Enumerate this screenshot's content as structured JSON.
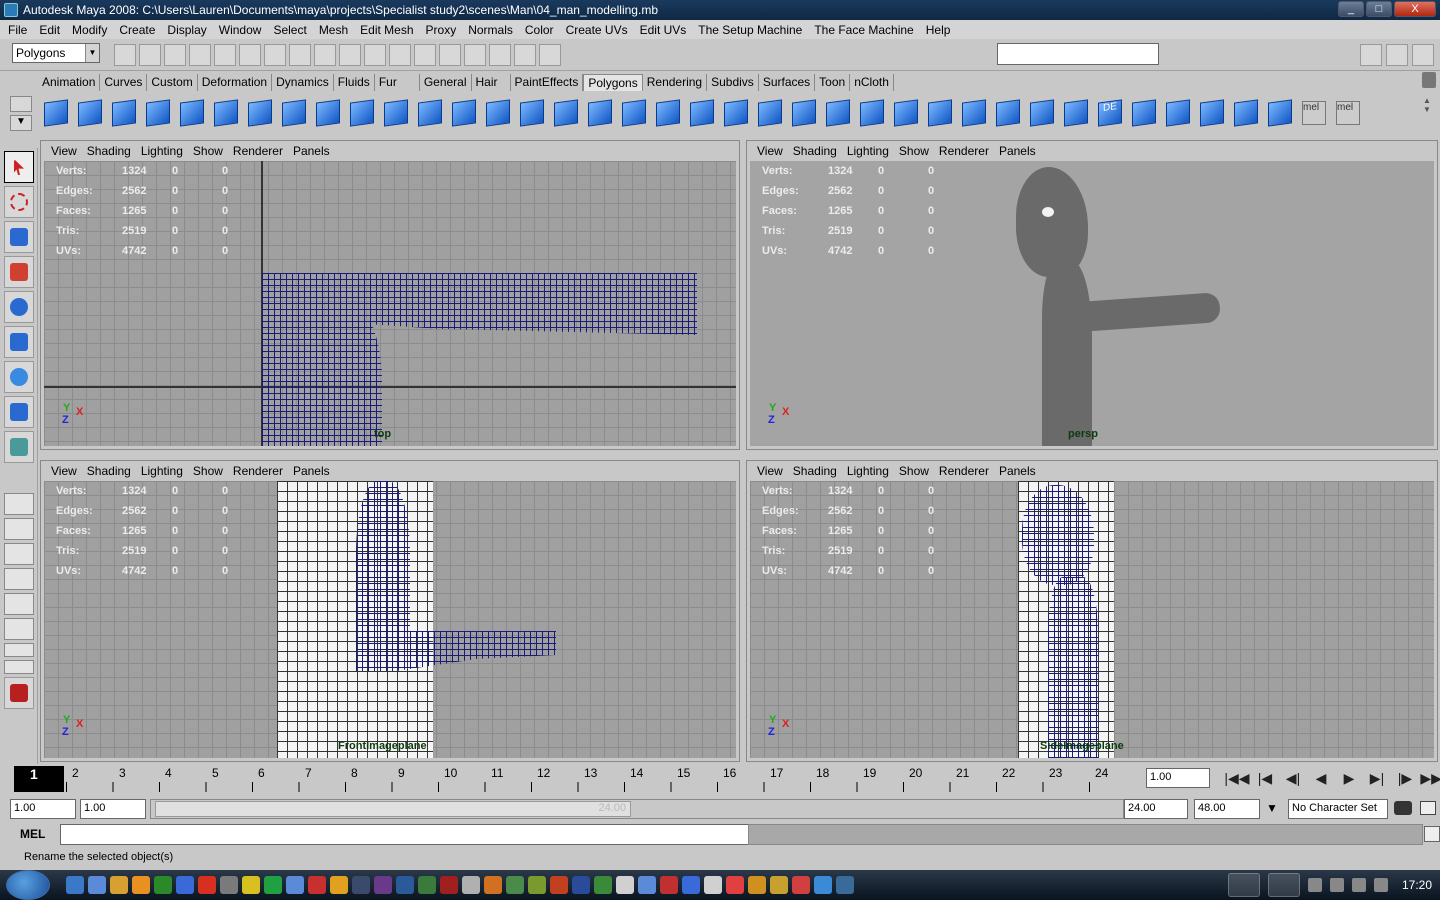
{
  "window": {
    "title": "Autodesk Maya 2008: C:\\Users\\Lauren\\Documents\\maya\\projects\\Specialist study2\\scenes\\Man\\04_man_modelling.mb",
    "min": "_",
    "max": "□",
    "close": "X"
  },
  "menu": [
    "File",
    "Edit",
    "Modify",
    "Create",
    "Display",
    "Window",
    "Select",
    "Mesh",
    "Edit Mesh",
    "Proxy",
    "Normals",
    "Color",
    "Create UVs",
    "Edit UVs",
    "The Setup Machine",
    "The Face Machine",
    "Help"
  ],
  "status_line": {
    "mode": "Polygons",
    "quick_field": ""
  },
  "shelf_tabs": [
    "Animation",
    "Curves",
    "Custom",
    "Deformation",
    "Dynamics",
    "Fluids",
    "Fur",
    "General",
    "Hair",
    "PaintEffects",
    "Polygons",
    "Rendering",
    "Subdivs",
    "Surfaces",
    "Toon",
    "nCloth"
  ],
  "active_shelf_tab": "Polygons",
  "shelf_icons": [
    "poly-sphere",
    "poly-cube",
    "poly-cylinder",
    "poly-cone",
    "poly-plane",
    "poly-torus",
    "poly-prism",
    "poly-pipe",
    "poly-helix",
    "combine",
    "separate",
    "extract",
    "smooth",
    "boolean",
    "average-vertices",
    "extrude-face",
    "bridge",
    "append-polygon",
    "split-polygon",
    "insert-edgeloop",
    "offset-edgeloop",
    "merge-vertices",
    "collapse",
    "bevel",
    "poke-face",
    "wedge-face",
    "triangulate",
    "quadrangulate",
    "fill-hole",
    "reduce",
    "mirror",
    "cleanup",
    "planar-mapping",
    "cylindrical-mapping",
    "spherical-mapping",
    "auto-mapping",
    "uv-layout",
    "uv-texture-editor",
    "mel",
    "mel"
  ],
  "mel_label": "mel",
  "de_label": "DE",
  "viewport_menu": [
    "View",
    "Shading",
    "Lighting",
    "Show",
    "Renderer",
    "Panels"
  ],
  "hud": {
    "rows": [
      {
        "label": "Verts:",
        "v1": "1324",
        "v2": "0",
        "v3": "0"
      },
      {
        "label": "Edges:",
        "v1": "2562",
        "v2": "0",
        "v3": "0"
      },
      {
        "label": "Faces:",
        "v1": "1265",
        "v2": "0",
        "v3": "0"
      },
      {
        "label": "Tris:",
        "v1": "2519",
        "v2": "0",
        "v3": "0"
      },
      {
        "label": "UVs:",
        "v1": "4742",
        "v2": "0",
        "v3": "0"
      }
    ]
  },
  "viewports": {
    "top": {
      "camera": "top",
      "axis": [
        "Y",
        "X",
        "Z"
      ]
    },
    "persp": {
      "camera": "persp",
      "axis": [
        "Y",
        "X",
        "Z"
      ]
    },
    "front": {
      "camera": "FrontImageplane",
      "axis": [
        "Y",
        "X",
        "Z"
      ]
    },
    "side": {
      "camera": "SideImageplane",
      "axis": [
        "Y",
        "X",
        "Z"
      ]
    }
  },
  "timeline": {
    "current_frame": "1",
    "ticks": [
      "1",
      "2",
      "3",
      "4",
      "5",
      "6",
      "7",
      "8",
      "9",
      "10",
      "11",
      "12",
      "13",
      "14",
      "15",
      "16",
      "17",
      "18",
      "19",
      "20",
      "21",
      "22",
      "23",
      "24"
    ],
    "current_time_field": "1.00",
    "playback_icons": [
      "go-to-start-icon",
      "step-back-key-icon",
      "step-back-frame-icon",
      "play-backward-icon",
      "play-forward-icon",
      "step-forward-frame-icon",
      "step-forward-key-icon",
      "go-to-end-icon"
    ],
    "playback_glyphs": [
      "|◀◀",
      "|◀",
      "◀|",
      "◀",
      "▶",
      "▶|",
      "|▶",
      "▶▶|"
    ]
  },
  "range": {
    "start": "1.00",
    "playback_start": "1.00",
    "range_end_label": "24.00",
    "playback_end": "24.00",
    "end": "48.00",
    "character_set": "No Character Set"
  },
  "command_line": {
    "language": "MEL",
    "value": "",
    "result": ""
  },
  "help_line": "Rename the selected object(s)",
  "taskbar": {
    "clock": "17:20"
  }
}
